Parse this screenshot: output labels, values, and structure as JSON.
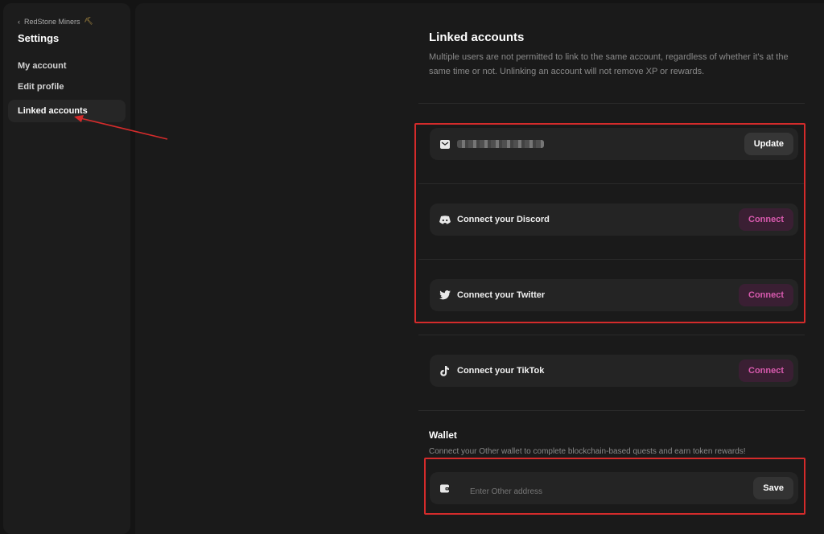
{
  "sidebar": {
    "back_label": "RedStone Miners",
    "back_icon": "chevron-left-icon",
    "title": "Settings",
    "items": [
      {
        "label": "My account"
      },
      {
        "label": "Edit profile"
      },
      {
        "label": "Linked accounts",
        "active": true
      }
    ]
  },
  "main": {
    "heading": "Linked accounts",
    "description": "Multiple users are not permitted to link to the same account, regardless of whether it's at the same time or not. Unlinking an account will not remove XP or rewards.",
    "accounts": [
      {
        "icon": "mail-icon",
        "label": "",
        "button": "Update"
      },
      {
        "icon": "discord-icon",
        "label": "Connect your Discord",
        "button": "Connect"
      },
      {
        "icon": "twitter-icon",
        "label": "Connect your Twitter",
        "button": "Connect"
      },
      {
        "icon": "tiktok-icon",
        "label": "Connect your TikTok",
        "button": "Connect"
      }
    ],
    "wallet": {
      "title": "Wallet",
      "description": "Connect your Other wallet to complete blockchain-based quests and earn token rewards!",
      "placeholder": "Enter Other address",
      "button": "Save",
      "icon": "wallet-icon"
    }
  },
  "colors": {
    "accent_pink": "#d85aae",
    "annotation_red": "#d42b2b"
  }
}
